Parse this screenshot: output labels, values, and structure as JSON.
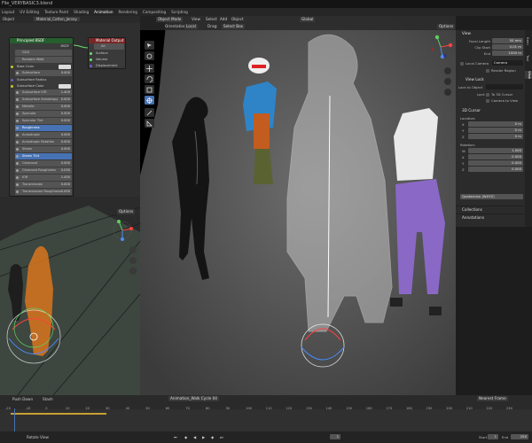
{
  "window": {
    "title": "File_VERYBASIC3.blend"
  },
  "workspaces": [
    "Layout",
    "UV Editing",
    "Texture Paint",
    "Shading",
    "Animation",
    "Rendering",
    "Compositing",
    "Scripting"
  ],
  "node_editor": {
    "header_left": "Object",
    "header_field": "Material_Cotton_Jersey",
    "bsdf_node": {
      "title": "Principled BSDF",
      "output": "BSDF",
      "distribution": "GGX",
      "subsurface_method": "Random Walk",
      "rows": [
        {
          "label": "Base Color",
          "value": "",
          "kind": "color"
        },
        {
          "label": "Subsurface",
          "value": "0.000",
          "kind": "slider"
        },
        {
          "label": "Subsurface Radius",
          "value": "",
          "kind": "plain"
        },
        {
          "label": "Subsurface Color",
          "value": "",
          "kind": "color"
        },
        {
          "label": "Subsurface IOR",
          "value": "1.400",
          "kind": "slider"
        },
        {
          "label": "Subsurface Anisotropy",
          "value": "0.000",
          "kind": "slider"
        },
        {
          "label": "Metallic",
          "value": "0.000",
          "kind": "slider"
        },
        {
          "label": "Specular",
          "value": "0.500",
          "kind": "slider"
        },
        {
          "label": "Specular Tint",
          "value": "0.000",
          "kind": "slider"
        },
        {
          "label": "Roughness",
          "value": "",
          "kind": "active"
        },
        {
          "label": "Anisotropic",
          "value": "0.000",
          "kind": "slider"
        },
        {
          "label": "Anisotropic Rotation",
          "value": "0.000",
          "kind": "slider"
        },
        {
          "label": "Sheen",
          "value": "0.000",
          "kind": "slider"
        },
        {
          "label": "Sheen Tint",
          "value": "",
          "kind": "active"
        },
        {
          "label": "Clearcoat",
          "value": "0.000",
          "kind": "slider"
        },
        {
          "label": "Clearcoat Roughness",
          "value": "0.030",
          "kind": "slider"
        },
        {
          "label": "IOR",
          "value": "1.450",
          "kind": "slider"
        },
        {
          "label": "Transmission",
          "value": "0.000",
          "kind": "slider"
        },
        {
          "label": "Transmission Roughness",
          "value": "0.000",
          "kind": "slider"
        },
        {
          "label": "Emission",
          "value": "",
          "kind": "color"
        },
        {
          "label": "Emission Strength",
          "value": "1.000",
          "kind": "slider"
        },
        {
          "label": "Alpha",
          "value": "1.000",
          "kind": "active"
        }
      ]
    },
    "output_node": {
      "title": "Material Output",
      "target": "All",
      "sockets": [
        "Surface",
        "Volume",
        "Displacement"
      ]
    }
  },
  "viewport2": {
    "options_label": "Options"
  },
  "viewport_main": {
    "mode": "Object Mode",
    "menus": [
      "View",
      "Select",
      "Add",
      "Object"
    ],
    "orientation_label": "Orientation:",
    "orientation_value": "Local",
    "drag_label": "Drag:",
    "drag_value": "Select Box",
    "transform_space": "Global",
    "options_label": "Options"
  },
  "sidebar": {
    "view_header": "View",
    "focal_length_label": "Focal Length",
    "focal_length": "50 mm",
    "clip_start_label": "Clip Start",
    "clip_start": "0.01 m",
    "clip_end_label": "End",
    "clip_end": "1000 m",
    "local_camera_label": "Local Camera",
    "local_camera": "Camera",
    "render_region": "Render Region",
    "view_lock_header": "View Lock",
    "lock_to_object_label": "Lock to Object",
    "lock_label": "Lock",
    "to_3d_cursor": "To 3D Cursor",
    "camera_to_view": "Camera to View",
    "cursor_header": "3D Cursor",
    "location_label": "Location:",
    "loc": [
      {
        "axis": "X",
        "value": "0 m"
      },
      {
        "axis": "Y",
        "value": "0 m"
      },
      {
        "axis": "Z",
        "value": "0 m"
      }
    ],
    "rotation_label": "Rotation:",
    "rot": [
      {
        "axis": "W",
        "value": "1.000"
      },
      {
        "axis": "X",
        "value": "0.000"
      },
      {
        "axis": "Y",
        "value": "0.000"
      },
      {
        "axis": "Z",
        "value": "0.000"
      }
    ],
    "rotation_mode": "Quaternion (WXYZ)",
    "collections": "Collections",
    "annotations": "Annotations",
    "tabs": [
      "Item",
      "Tool",
      "View"
    ]
  },
  "timeline": {
    "playback": "Playback",
    "keying": "Keying",
    "view": "View",
    "marker": "Marker",
    "push_down": "Push Down",
    "stash": "Stash",
    "action": "Animation_Walk Cycle 04",
    "nearest_frame": "Nearest Frame",
    "ticks": [
      "-20",
      "-10",
      "0",
      "10",
      "20",
      "30",
      "40",
      "50",
      "60",
      "70",
      "80",
      "90",
      "100",
      "110",
      "120",
      "130",
      "140",
      "150",
      "160",
      "170",
      "180",
      "190",
      "200",
      "210",
      "220",
      "230"
    ],
    "current_frame": "1",
    "start_label": "Start",
    "start": "1",
    "end_label": "End",
    "end": "250"
  },
  "statusbar": {
    "left": "Rotate View"
  }
}
